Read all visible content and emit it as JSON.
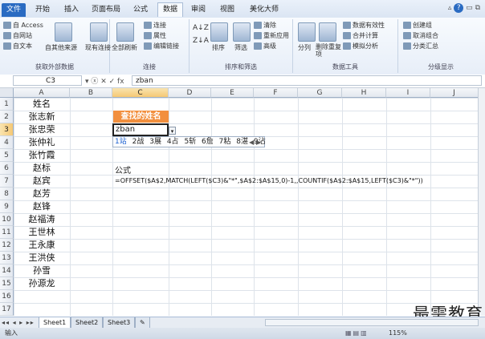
{
  "ribbon_tabs": [
    "文件",
    "开始",
    "插入",
    "页面布局",
    "公式",
    "数据",
    "审阅",
    "视图",
    "美化大师"
  ],
  "active_tab": "数据",
  "ribbon": {
    "get_external": {
      "items": [
        "自 Access",
        "自网站",
        "自文本",
        "自其他来源",
        "现有连接"
      ],
      "label": "获取外部数据"
    },
    "connections": {
      "items": [
        "全部刷新",
        "连接",
        "属性",
        "编辑链接"
      ],
      "label": "连接"
    },
    "sort_filter": {
      "items": [
        "排序",
        "筛选",
        "清除",
        "重新应用",
        "高级"
      ],
      "label": "排序和筛选"
    },
    "data_tools": {
      "items": [
        "分列",
        "删除重复项",
        "数据有效性",
        "合并计算",
        "模拟分析"
      ],
      "label": "数据工具"
    },
    "outline": {
      "items": [
        "创建组",
        "取消组合",
        "分类汇总"
      ],
      "label": "分级显示"
    }
  },
  "formula_bar": {
    "name_box": "C3",
    "fx_icons": "▾ ⓧ ✕ ✓ fx",
    "formula": "zban"
  },
  "columns": [
    "A",
    "B",
    "C",
    "D",
    "E",
    "F",
    "G",
    "H",
    "I",
    "J"
  ],
  "selected_column": "C",
  "rows": [
    "1",
    "2",
    "3",
    "4",
    "5",
    "6",
    "7",
    "8",
    "9",
    "10",
    "11",
    "12",
    "13",
    "14",
    "15",
    "16",
    "17"
  ],
  "selected_row": "3",
  "column_a": [
    "姓名",
    "张志新",
    "张忠荣",
    "张仲礼",
    "张竹霞",
    "赵标",
    "赵宾",
    "赵芳",
    "赵锋",
    "赵福涛",
    "王世林",
    "王永康",
    "王洪侠",
    "孙雪",
    "孙源龙"
  ],
  "lookup_header": "查找的姓名",
  "edit_value": "zban",
  "ime_candidates": [
    "1站",
    "2战",
    "3展",
    "4占",
    "5斩",
    "6詹",
    "7粘",
    "8湛",
    "9沾"
  ],
  "ime_arrows": "◀ ▶",
  "formula_label": "公式",
  "formula_text": "=OFFSET($A$2,MATCH(LEFT($C3)&\"*\",$A$2:$A$15,0)-1,,COUNTIF($A$2:$A$15,LEFT($C3)&\"*\"))",
  "sheet_tabs": [
    "Sheet1",
    "Sheet2",
    "Sheet3"
  ],
  "active_sheet": "Sheet1",
  "sheet_nav": "◂◂ ◂ ▸ ▸▸",
  "status": {
    "left": "输入",
    "right": "115%"
  },
  "watermark": "最需教育"
}
